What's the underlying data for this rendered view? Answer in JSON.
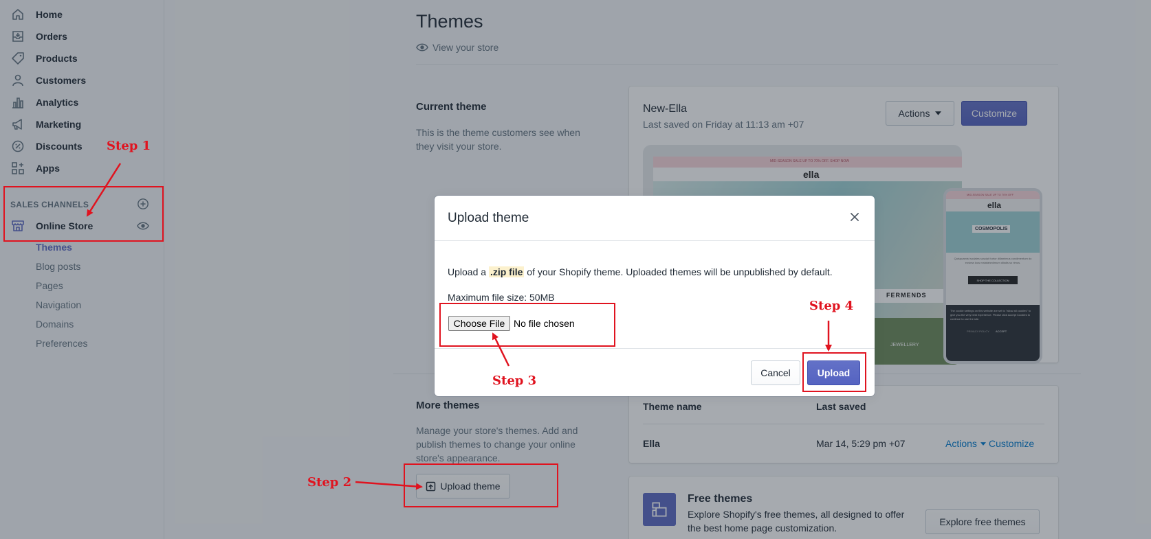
{
  "sidebar": {
    "items": [
      {
        "label": "Home",
        "icon": "home-icon"
      },
      {
        "label": "Orders",
        "icon": "orders-icon"
      },
      {
        "label": "Products",
        "icon": "tag-icon"
      },
      {
        "label": "Customers",
        "icon": "person-icon"
      },
      {
        "label": "Analytics",
        "icon": "bar-chart-icon"
      },
      {
        "label": "Marketing",
        "icon": "megaphone-icon"
      },
      {
        "label": "Discounts",
        "icon": "discount-icon"
      },
      {
        "label": "Apps",
        "icon": "apps-icon"
      }
    ],
    "channels_header": "SALES CHANNELS",
    "online_store": "Online Store",
    "sub_items": [
      "Themes",
      "Blog posts",
      "Pages",
      "Navigation",
      "Domains",
      "Preferences"
    ]
  },
  "page": {
    "title": "Themes",
    "view_store": "View your store"
  },
  "current_theme": {
    "section_title": "Current theme",
    "section_desc_1": "This is the theme customers see when",
    "section_desc_2": "they visit your store.",
    "theme_name": "New-Ella",
    "last_saved": "Last saved on Friday at 11:13 am +07",
    "actions_label": "Actions",
    "customize_label": "Customize"
  },
  "preview": {
    "banner": "MID-SEASON SALE UP TO 70% OFF. SHOP NOW",
    "logo": "ella",
    "fermends": "FERMENDS",
    "jewellery": "JEWELLERY",
    "mobile_banner": "MID-SEASON SALE UP TO 70% OFF",
    "mobile_logo": "ella",
    "cosmopolis": "COSMOPOLIS",
    "mobile_copy": "Quisquamist sodales suscipit tortor dillamimus condimentum do eosima lous malafahedimum diisdis so rimus.",
    "shop_collection": "SHOP THE COLLECTION",
    "cookie_text": "The cookie settings on this website are set to \"allow all cookies\" to give you the very best experience. Please click Accept Cookies to continue to use the site.",
    "privacy": "PRIVACY POLICY",
    "accept": "ACCEPT"
  },
  "more_themes": {
    "section_title": "More themes",
    "desc_1": "Manage your store's themes. Add and",
    "desc_2": "publish themes to change your online",
    "desc_3": "store's appearance.",
    "upload_label": "Upload theme",
    "col_name": "Theme name",
    "col_saved": "Last saved",
    "row_name": "Ella",
    "row_saved": "Mar 14, 5:29 pm +07",
    "row_actions": "Actions",
    "row_customize": "Customize"
  },
  "free_themes": {
    "title": "Free themes",
    "desc_1": "Explore Shopify's free themes, all designed to offer",
    "desc_2": "the best home page customization.",
    "button": "Explore free themes"
  },
  "modal": {
    "title": "Upload theme",
    "text_before": "Upload a ",
    "text_highlight": ".zip file",
    "text_after": " of your Shopify theme. Uploaded themes will be unpublished by default.",
    "max_size": "Maximum file size: 50MB",
    "choose_file": "Choose File",
    "no_file": "No file chosen",
    "cancel": "Cancel",
    "upload": "Upload"
  },
  "annotations": {
    "step1": "Step 1",
    "step2": "Step 2",
    "step3": "Step 3",
    "step4": "Step 4"
  },
  "colors": {
    "primary": "#5c6ac4",
    "link": "#007ace",
    "annotation": "#e0131f"
  }
}
